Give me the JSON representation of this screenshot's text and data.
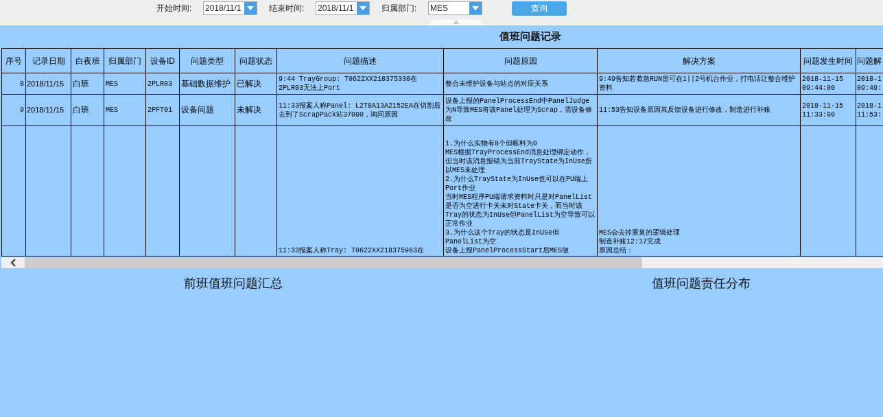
{
  "filters": [
    {
      "label": "开始时间:",
      "value": "2018/11/1"
    },
    {
      "label": "结束时间:",
      "value": "2018/11/1"
    },
    {
      "label": "归属部门:",
      "value": "MES"
    }
  ],
  "query_button": "查询",
  "table": {
    "title": "值班问题记录",
    "columns": [
      "序号",
      "记录日期",
      "白夜班",
      "归属部门",
      "设备ID",
      "问题类型",
      "问题状态",
      "问题描述",
      "问题原因",
      "解决方案",
      "问题发生时间",
      "问题解"
    ],
    "rows": [
      {
        "cells": [
          "8",
          "2018/11/15",
          "白班",
          "MES",
          "2PLR03",
          "基础数据维护",
          "已解决",
          "9:44 TrayGroup: T0622XX218375330在2PLR03无法上Port",
          "整合未维护设备与站点的对应关系",
          "9:49告知若着急RUN货可在1||2号机台作业，打电话让整合维护资料",
          "2018-11-15 09:44:00",
          "2018-1 09:49:"
        ]
      },
      {
        "cells": [
          "9",
          "2018/11/15",
          "白班",
          "MES",
          "2PFT01",
          "设备问题",
          "未解决",
          "11:33报案人称Panel: L2T8A13A2152EA在切割后去到了ScrapPack站37000，询问原因",
          "设备上报的PanelProcessEnd中PanelJudge为N导致MES将该Panel处理为Scrap，需设备修改",
          "11:53告知设备原因其反馈设备进行修改，制造进行补账",
          "2018-11-15 11:33:00",
          "2018-1 11:53:"
        ]
      },
      {
        "cells": [
          "",
          "",
          "",
          "",
          "",
          "",
          "",
          "11:33报案人称Tray: T0622XX218375963在",
          [
            "1.为什么实物有8个但帐料为0",
            "MES根据TrayProcessEnd消息处理绑定动作，但当时该消息报错为当前TrayState为InUse所以MES未处理",
            "2.为什么TrayState为InUse也可以在PU端上Port作业",
            "当时MES程序PU端请求资料时只是对PanelList是否为空进行卡关未对State卡关，而当时该Tray的状态为InUse但PanelList为空导致可以正常作业",
            "3.为什么这个Tray的状态是InUse但PanelList为空",
            "设备上报PanelProcessStart后MES做"
          ],
          [
            "MES会去掉重复的逻辑处理",
            "制造补账12:17完成",
            "原因总结："
          ],
          "",
          ""
        ]
      }
    ]
  },
  "sections": [
    "前班值班问题汇总",
    "值班问题责任分布"
  ]
}
